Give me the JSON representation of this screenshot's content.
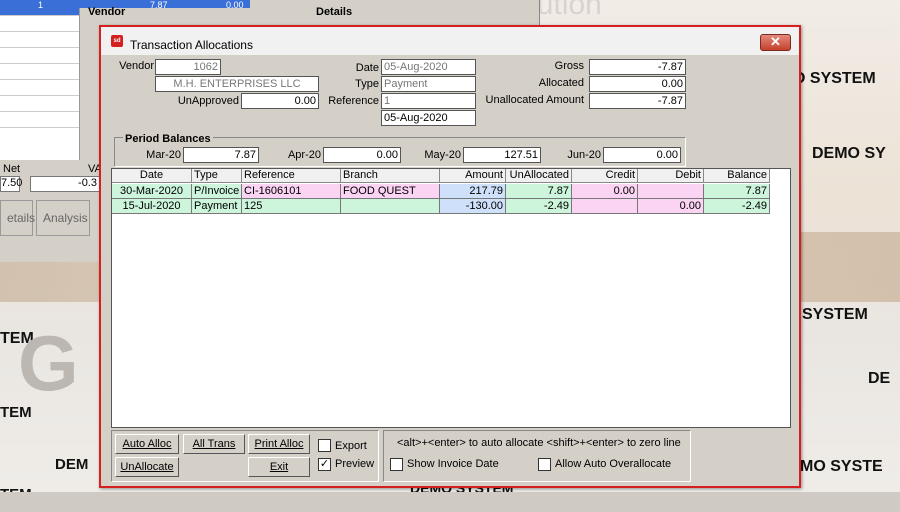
{
  "background": {
    "top_text": "Integrated Solution",
    "demo_labels": [
      "O SYSTEM",
      "DEMO SY",
      "SYSTEM",
      "DE",
      "MO SYSTE",
      "DEMO SYSTEM",
      "TEM",
      "TEM",
      "DEM",
      "TEM"
    ]
  },
  "underlying": {
    "row1_col1": "1",
    "row1_col3": "7.87",
    "row1_col4": "0.00",
    "vendor_header": "Vendor",
    "details_header": "Details",
    "net_label": "Net",
    "va_label": "VA",
    "net_value": "7.50",
    "va_value": "-0.3",
    "tabs": [
      "etails",
      "Analysis"
    ]
  },
  "dialog": {
    "title": "Transaction Allocations",
    "close_glyph": "✕",
    "vendor_label": "Vendor",
    "vendor_code": "1062",
    "vendor_name": "M.H. ENTERPRISES LLC",
    "unapproved_label": "UnApproved",
    "unapproved_value": "0.00",
    "date_label": "Date",
    "date_value": "05-Aug-2020",
    "type_label": "Type",
    "type_value": "Payment",
    "reference_label": "Reference",
    "reference_value": "1",
    "extra_date": "05-Aug-2020",
    "gross_label": "Gross",
    "gross_value": "-7.87",
    "allocated_label": "Allocated",
    "allocated_value": "0.00",
    "unallocated_label": "Unallocated Amount",
    "unallocated_value": "-7.87"
  },
  "period_balances": {
    "title": "Period Balances",
    "periods": [
      {
        "label": "Mar-20",
        "value": "7.87"
      },
      {
        "label": "Apr-20",
        "value": "0.00"
      },
      {
        "label": "May-20",
        "value": "127.51"
      },
      {
        "label": "Jun-20",
        "value": "0.00"
      }
    ]
  },
  "grid": {
    "headers": [
      "Date",
      "Type",
      "Reference",
      "Branch",
      "Amount",
      "UnAllocated",
      "Credit",
      "Debit",
      "Balance"
    ],
    "rows": [
      [
        "30-Mar-2020",
        "P/Invoice",
        "CI-1606101",
        "FOOD QUEST",
        "217.79",
        "7.87",
        "0.00",
        "",
        "7.87"
      ],
      [
        "15-Jul-2020",
        "Payment",
        "125",
        "",
        "-130.00",
        "-2.49",
        "",
        "0.00",
        "-2.49"
      ]
    ],
    "colors": {
      "green": "#ccf5dc",
      "pink": "#fbd3f3",
      "blue": "#cfe0fb"
    }
  },
  "buttons": {
    "auto_alloc": "Auto Alloc",
    "all_trans": "All Trans",
    "print_alloc": "Print Alloc",
    "unallocate": "UnAllocate",
    "exit": "Exit",
    "export_label": "Export",
    "preview_label": "Preview",
    "preview_checked": "✓",
    "hint_text": "<alt>+<enter> to auto allocate   <shift>+<enter> to zero line",
    "show_invoice_date_label": "Show Invoice Date",
    "allow_overallocate_label": "Allow Auto Overallocate"
  },
  "accent_color": "#d62020"
}
